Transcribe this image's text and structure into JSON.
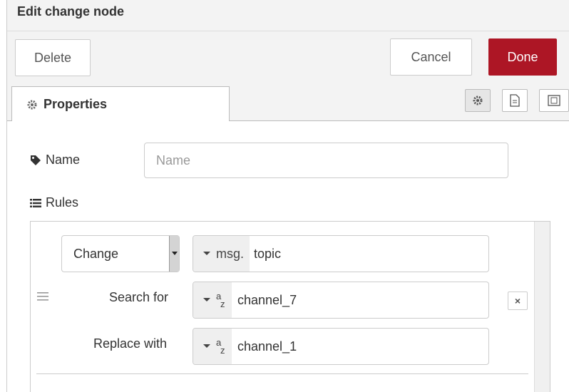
{
  "header": {
    "title": "Edit change node"
  },
  "toolbar": {
    "delete_label": "Delete",
    "cancel_label": "Cancel",
    "done_label": "Done",
    "done_color": "#ad1625"
  },
  "tabs": {
    "properties_label": "Properties",
    "icons": [
      "gear-icon",
      "description-icon",
      "appearance-icon"
    ]
  },
  "form": {
    "name_label": "Name",
    "name_placeholder": "Name",
    "name_value": "",
    "rules_label": "Rules"
  },
  "rule": {
    "action": "Change",
    "property_prefix": "msg.",
    "property_value": "topic",
    "search_label": "Search for",
    "search_value": "channel_7",
    "replace_label": "Replace with",
    "replace_value": "channel_1",
    "remove_glyph": "×"
  }
}
